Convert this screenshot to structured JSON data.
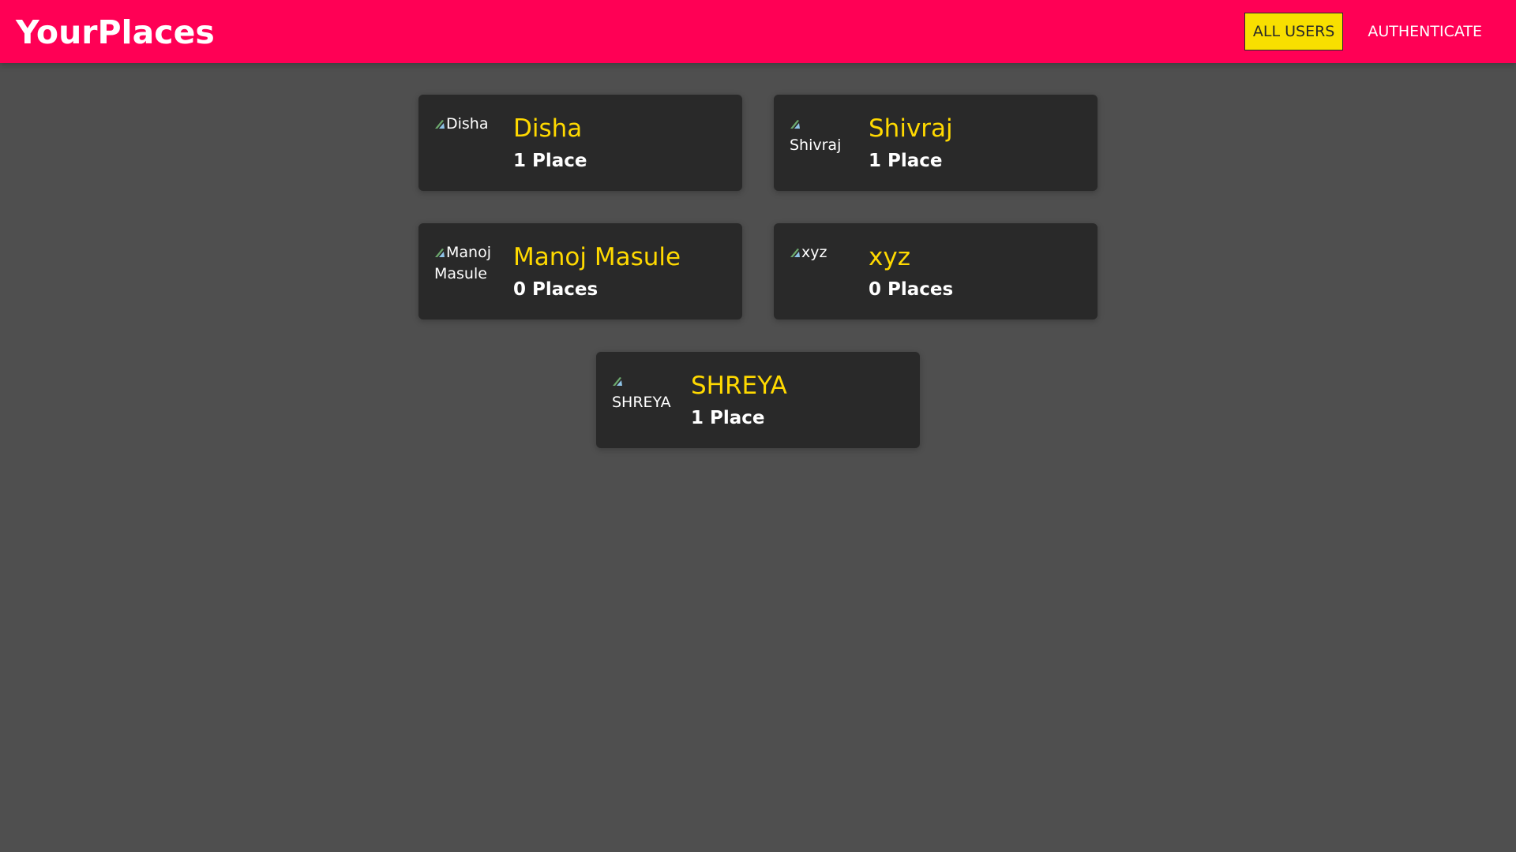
{
  "header": {
    "logo": "YourPlaces",
    "nav": [
      {
        "label": "ALL USERS",
        "active": true
      },
      {
        "label": "AUTHENTICATE",
        "active": false
      }
    ]
  },
  "colors": {
    "header_bg": "#ff0055",
    "page_bg": "#4f4f4f",
    "card_bg": "#292929",
    "accent_yellow": "#ffd900",
    "active_nav_bg": "#f8df00"
  },
  "users": [
    {
      "name": "Disha",
      "avatar_alt": "Disha",
      "places": "1 Place",
      "icon": "broken-image-icon"
    },
    {
      "name": "Shivraj",
      "avatar_alt": "Shivraj",
      "places": "1 Place",
      "icon": "broken-image-icon"
    },
    {
      "name": "Manoj Masule",
      "avatar_alt": "Manoj Masule",
      "places": "0 Places",
      "icon": "broken-image-icon"
    },
    {
      "name": "xyz",
      "avatar_alt": "xyz",
      "places": "0 Places",
      "icon": "broken-image-icon"
    },
    {
      "name": "SHREYA",
      "avatar_alt": "SHREYA",
      "places": "1 Place",
      "icon": "broken-image-icon"
    }
  ]
}
